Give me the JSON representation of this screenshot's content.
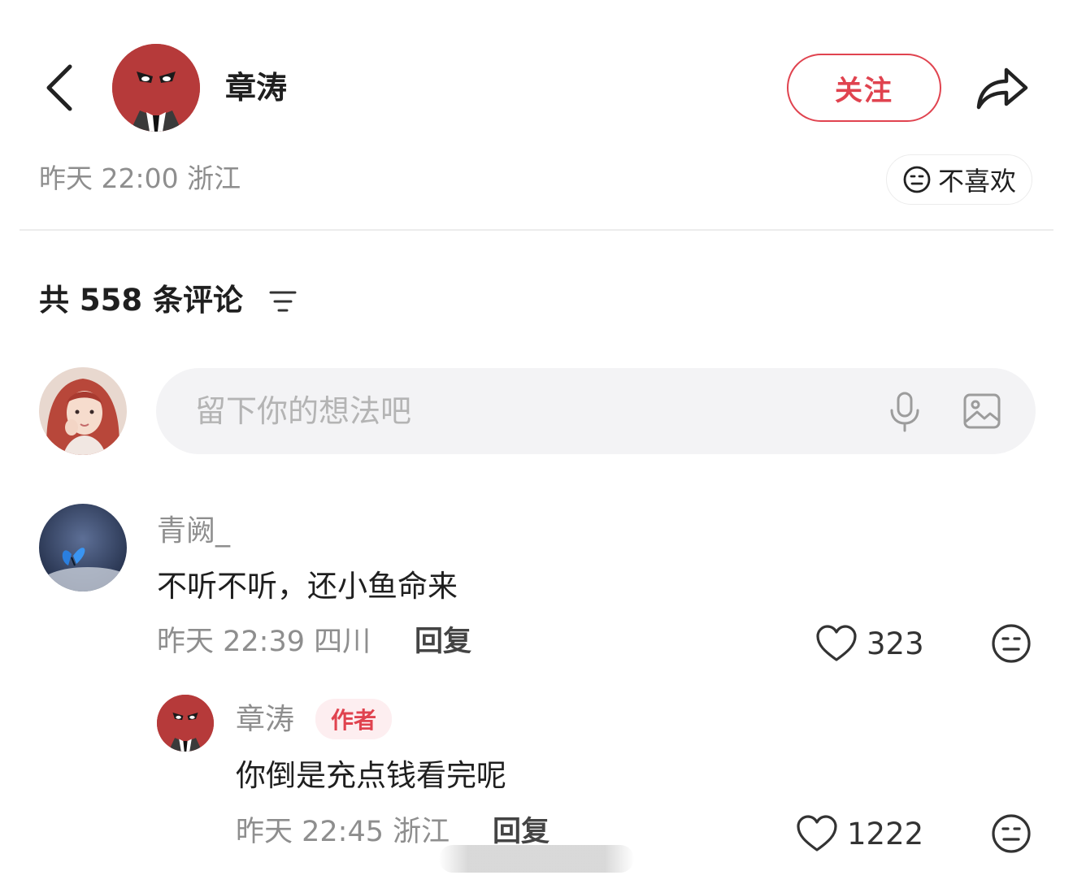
{
  "header": {
    "back_icon": "chevron-left-icon",
    "author_name": "章涛",
    "follow_label": "关注",
    "share_icon": "share-arrow-icon",
    "meta_time": "昨天 22:00",
    "meta_location": "浙江",
    "dislike_label": "不喜欢",
    "dislike_icon": "neutral-face-icon"
  },
  "comments_header": {
    "prefix": "共",
    "count": "558",
    "suffix": "条评论",
    "sort_icon": "sort-filter-icon"
  },
  "input": {
    "placeholder": "留下你的想法吧",
    "mic_icon": "microphone-icon",
    "image_icon": "image-icon"
  },
  "comments": [
    {
      "user": "青阙_",
      "text": "不听不听，还小鱼命来",
      "time": "昨天 22:39",
      "location": "四川",
      "reply_label": "回复",
      "likes": "323",
      "replies": [
        {
          "user": "章涛",
          "tag": "作者",
          "text": "你倒是充点钱看完呢",
          "time": "昨天 22:45",
          "location": "浙江",
          "reply_label": "回复",
          "likes": "1222"
        }
      ]
    }
  ],
  "colors": {
    "accent": "#e0434f",
    "avatar_red": "#b63a3a",
    "grey_text": "#8e8e8e",
    "input_bg": "#f3f3f5"
  }
}
